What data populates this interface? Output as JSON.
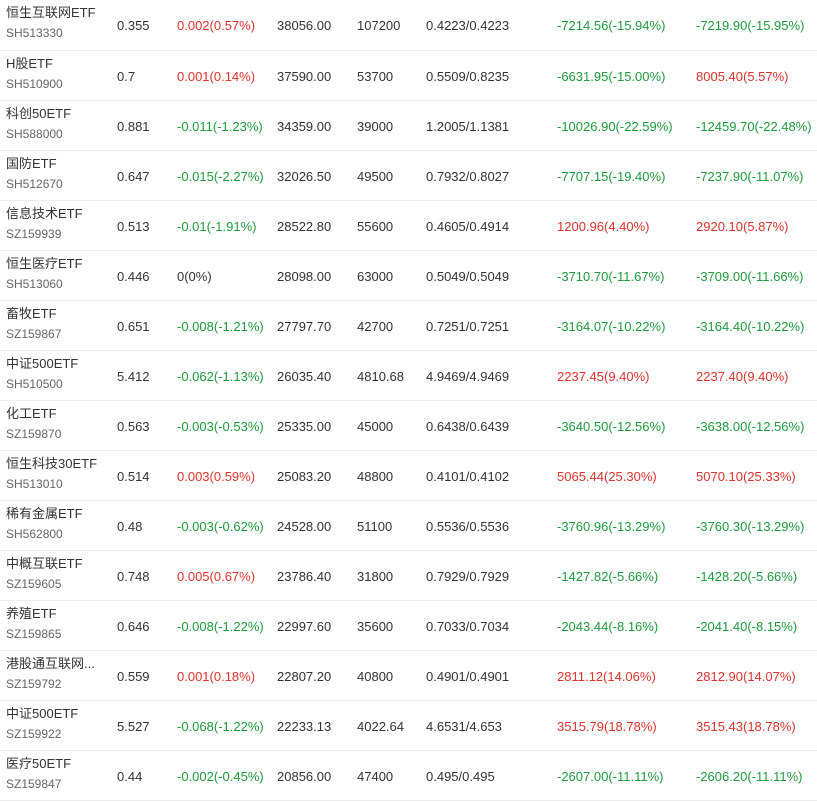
{
  "colors": {
    "up": "#e0332b",
    "down": "#1e9b3c",
    "flat": "#333333",
    "border": "#ececec"
  },
  "rows": [
    {
      "name": "恒生互联网ETF",
      "code": "SH513330",
      "price": "0.355",
      "chg": "0.002(0.57%)",
      "chg_dir": "up",
      "vol": "38056.00",
      "shares": "107200",
      "range": "0.4223/0.4223",
      "pl1": "-7214.56(-15.94%)",
      "pl1_dir": "down",
      "pl2": "-7219.90(-15.95%)",
      "pl2_dir": "down"
    },
    {
      "name": "H股ETF",
      "code": "SH510900",
      "price": "0.7",
      "chg": "0.001(0.14%)",
      "chg_dir": "up",
      "vol": "37590.00",
      "shares": "53700",
      "range": "0.5509/0.8235",
      "pl1": "-6631.95(-15.00%)",
      "pl1_dir": "down",
      "pl2": "8005.40(5.57%)",
      "pl2_dir": "up"
    },
    {
      "name": "科创50ETF",
      "code": "SH588000",
      "price": "0.881",
      "chg": "-0.011(-1.23%)",
      "chg_dir": "down",
      "vol": "34359.00",
      "shares": "39000",
      "range": "1.2005/1.1381",
      "pl1": "-10026.90(-22.59%)",
      "pl1_dir": "down",
      "pl2": "-12459.70(-22.48%)",
      "pl2_dir": "down"
    },
    {
      "name": "国防ETF",
      "code": "SH512670",
      "price": "0.647",
      "chg": "-0.015(-2.27%)",
      "chg_dir": "down",
      "vol": "32026.50",
      "shares": "49500",
      "range": "0.7932/0.8027",
      "pl1": "-7707.15(-19.40%)",
      "pl1_dir": "down",
      "pl2": "-7237.90(-11.07%)",
      "pl2_dir": "down"
    },
    {
      "name": "信息技术ETF",
      "code": "SZ159939",
      "price": "0.513",
      "chg": "-0.01(-1.91%)",
      "chg_dir": "down",
      "vol": "28522.80",
      "shares": "55600",
      "range": "0.4605/0.4914",
      "pl1": "1200.96(4.40%)",
      "pl1_dir": "up",
      "pl2": "2920.10(5.87%)",
      "pl2_dir": "up"
    },
    {
      "name": "恒生医疗ETF",
      "code": "SH513060",
      "price": "0.446",
      "chg": "0(0%)",
      "chg_dir": "flat",
      "vol": "28098.00",
      "shares": "63000",
      "range": "0.5049/0.5049",
      "pl1": "-3710.70(-11.67%)",
      "pl1_dir": "down",
      "pl2": "-3709.00(-11.66%)",
      "pl2_dir": "down"
    },
    {
      "name": "畜牧ETF",
      "code": "SZ159867",
      "price": "0.651",
      "chg": "-0.008(-1.21%)",
      "chg_dir": "down",
      "vol": "27797.70",
      "shares": "42700",
      "range": "0.7251/0.7251",
      "pl1": "-3164.07(-10.22%)",
      "pl1_dir": "down",
      "pl2": "-3164.40(-10.22%)",
      "pl2_dir": "down"
    },
    {
      "name": "中证500ETF",
      "code": "SH510500",
      "price": "5.412",
      "chg": "-0.062(-1.13%)",
      "chg_dir": "down",
      "vol": "26035.40",
      "shares": "4810.68",
      "range": "4.9469/4.9469",
      "pl1": "2237.45(9.40%)",
      "pl1_dir": "up",
      "pl2": "2237.40(9.40%)",
      "pl2_dir": "up"
    },
    {
      "name": "化工ETF",
      "code": "SZ159870",
      "price": "0.563",
      "chg": "-0.003(-0.53%)",
      "chg_dir": "down",
      "vol": "25335.00",
      "shares": "45000",
      "range": "0.6438/0.6439",
      "pl1": "-3640.50(-12.56%)",
      "pl1_dir": "down",
      "pl2": "-3638.00(-12.56%)",
      "pl2_dir": "down"
    },
    {
      "name": "恒生科技30ETF",
      "code": "SH513010",
      "price": "0.514",
      "chg": "0.003(0.59%)",
      "chg_dir": "up",
      "vol": "25083.20",
      "shares": "48800",
      "range": "0.4101/0.4102",
      "pl1": "5065.44(25.30%)",
      "pl1_dir": "up",
      "pl2": "5070.10(25.33%)",
      "pl2_dir": "up"
    },
    {
      "name": "稀有金属ETF",
      "code": "SH562800",
      "price": "0.48",
      "chg": "-0.003(-0.62%)",
      "chg_dir": "down",
      "vol": "24528.00",
      "shares": "51100",
      "range": "0.5536/0.5536",
      "pl1": "-3760.96(-13.29%)",
      "pl1_dir": "down",
      "pl2": "-3760.30(-13.29%)",
      "pl2_dir": "down"
    },
    {
      "name": "中概互联ETF",
      "code": "SZ159605",
      "price": "0.748",
      "chg": "0.005(0.67%)",
      "chg_dir": "up",
      "vol": "23786.40",
      "shares": "31800",
      "range": "0.7929/0.7929",
      "pl1": "-1427.82(-5.66%)",
      "pl1_dir": "down",
      "pl2": "-1428.20(-5.66%)",
      "pl2_dir": "down"
    },
    {
      "name": "养殖ETF",
      "code": "SZ159865",
      "price": "0.646",
      "chg": "-0.008(-1.22%)",
      "chg_dir": "down",
      "vol": "22997.60",
      "shares": "35600",
      "range": "0.7033/0.7034",
      "pl1": "-2043.44(-8.16%)",
      "pl1_dir": "down",
      "pl2": "-2041.40(-8.15%)",
      "pl2_dir": "down"
    },
    {
      "name": "港股通互联网...",
      "code": "SZ159792",
      "price": "0.559",
      "chg": "0.001(0.18%)",
      "chg_dir": "up",
      "vol": "22807.20",
      "shares": "40800",
      "range": "0.4901/0.4901",
      "pl1": "2811.12(14.06%)",
      "pl1_dir": "up",
      "pl2": "2812.90(14.07%)",
      "pl2_dir": "up"
    },
    {
      "name": "中证500ETF",
      "code": "SZ159922",
      "price": "5.527",
      "chg": "-0.068(-1.22%)",
      "chg_dir": "down",
      "vol": "22233.13",
      "shares": "4022.64",
      "range": "4.6531/4.653",
      "pl1": "3515.79(18.78%)",
      "pl1_dir": "up",
      "pl2": "3515.43(18.78%)",
      "pl2_dir": "up"
    },
    {
      "name": "医疗50ETF",
      "code": "SZ159847",
      "price": "0.44",
      "chg": "-0.002(-0.45%)",
      "chg_dir": "down",
      "vol": "20856.00",
      "shares": "47400",
      "range": "0.495/0.495",
      "pl1": "-2607.00(-11.11%)",
      "pl1_dir": "down",
      "pl2": "-2606.20(-11.11%)",
      "pl2_dir": "down"
    }
  ]
}
